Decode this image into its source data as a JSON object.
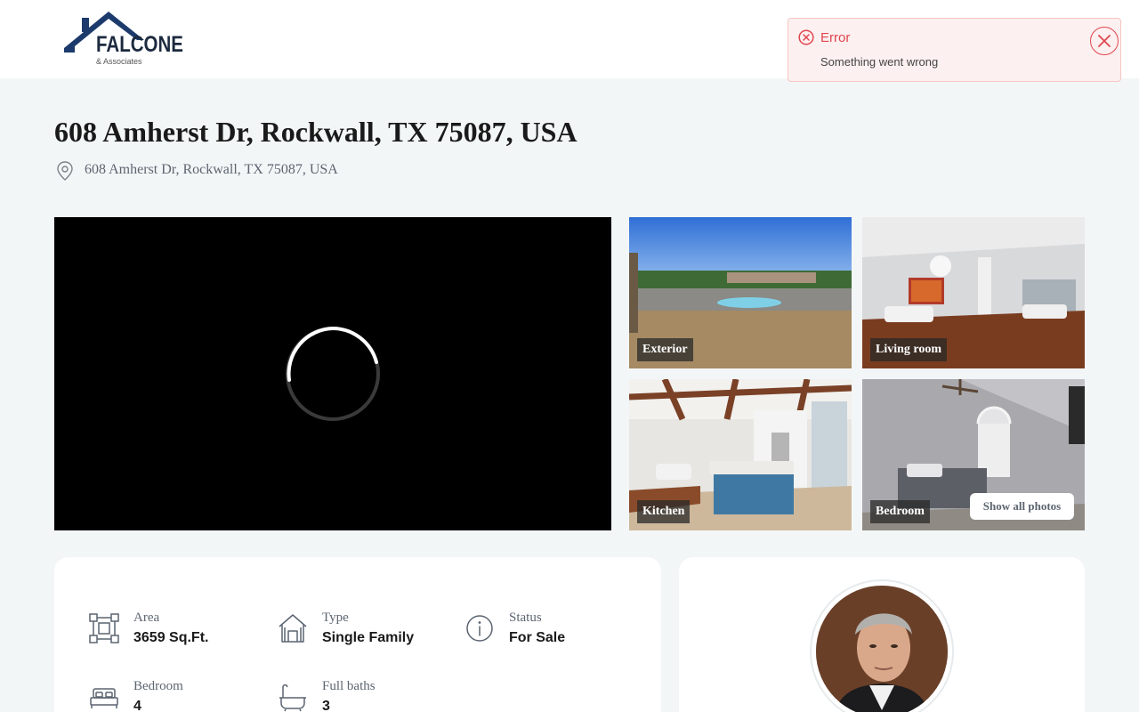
{
  "brand": {
    "name": "FALCONE",
    "sub": "& Associates"
  },
  "toast": {
    "title": "Error",
    "message": "Something went wrong"
  },
  "listing": {
    "title": "608 Amherst Dr, Rockwall, TX 75087, USA",
    "address": "608 Amherst Dr, Rockwall, TX 75087, USA"
  },
  "photos": [
    {
      "label": "Exterior"
    },
    {
      "label": "Living room"
    },
    {
      "label": "Kitchen"
    },
    {
      "label": "Bedroom"
    }
  ],
  "gallery": {
    "show_all_label": "Show all photos"
  },
  "features": [
    {
      "label": "Area",
      "value": "3659 Sq.Ft.",
      "icon": "area-icon"
    },
    {
      "label": "Type",
      "value": "Single Family",
      "icon": "house-icon"
    },
    {
      "label": "Status",
      "value": "For Sale",
      "icon": "info-icon"
    },
    {
      "label": "Bedroom",
      "value": "4",
      "icon": "bed-icon"
    },
    {
      "label": "Full baths",
      "value": "3",
      "icon": "bathtub-icon"
    }
  ],
  "colors": {
    "error": "#e0464e",
    "brand": "#1c3a6b",
    "text_muted": "#5d6570",
    "background": "#f3f6f7"
  }
}
